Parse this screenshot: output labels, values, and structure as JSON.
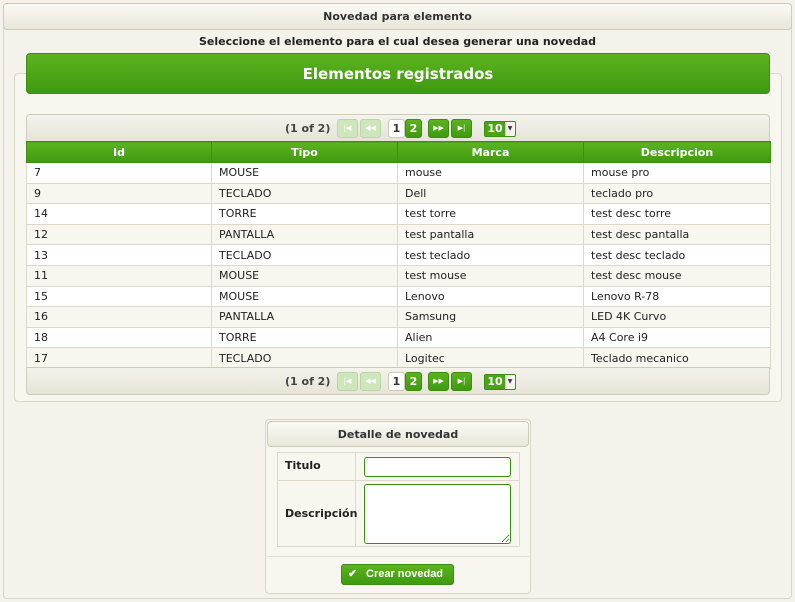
{
  "header": {
    "title": "Novedad para elemento"
  },
  "instruction": "Seleccione el elemento para el cual desea generar una novedad",
  "list": {
    "title": "Elementos registrados",
    "paginator": {
      "count": "(1 of 2)",
      "pages": [
        "1",
        "2"
      ],
      "current_page": "2",
      "rows_per_page": "10",
      "first_icon": "first-page-icon",
      "prev_icon": "prev-page-icon",
      "next_icon": "next-page-icon",
      "last_icon": "last-page-icon"
    },
    "columns": [
      "Id",
      "Tipo",
      "Marca",
      "Descripcion"
    ],
    "rows": [
      [
        "7",
        "MOUSE",
        "mouse",
        "mouse pro"
      ],
      [
        "9",
        "TECLADO",
        "Dell",
        "teclado pro"
      ],
      [
        "14",
        "TORRE",
        "test torre",
        "test desc torre"
      ],
      [
        "12",
        "PANTALLA",
        "test pantalla",
        "test desc pantalla"
      ],
      [
        "13",
        "TECLADO",
        "test teclado",
        "test desc teclado"
      ],
      [
        "11",
        "MOUSE",
        "test mouse",
        "test desc mouse"
      ],
      [
        "15",
        "MOUSE",
        "Lenovo",
        "Lenovo R-78"
      ],
      [
        "16",
        "PANTALLA",
        "Samsung",
        "LED 4K Curvo"
      ],
      [
        "18",
        "TORRE",
        "Alien",
        "A4 Core i9"
      ],
      [
        "17",
        "TECLADO",
        "Logitec",
        "Teclado mecanico"
      ]
    ]
  },
  "detail": {
    "title": "Detalle de novedad",
    "titulo_label": "Titulo",
    "titulo_value": "",
    "descripcion_label": "Descripción",
    "descripcion_value": "",
    "submit_label": "Crear novedad",
    "submit_icon": "check-icon"
  },
  "colors": {
    "accent_green": "#4aa516",
    "background": "#f4f2ea"
  }
}
